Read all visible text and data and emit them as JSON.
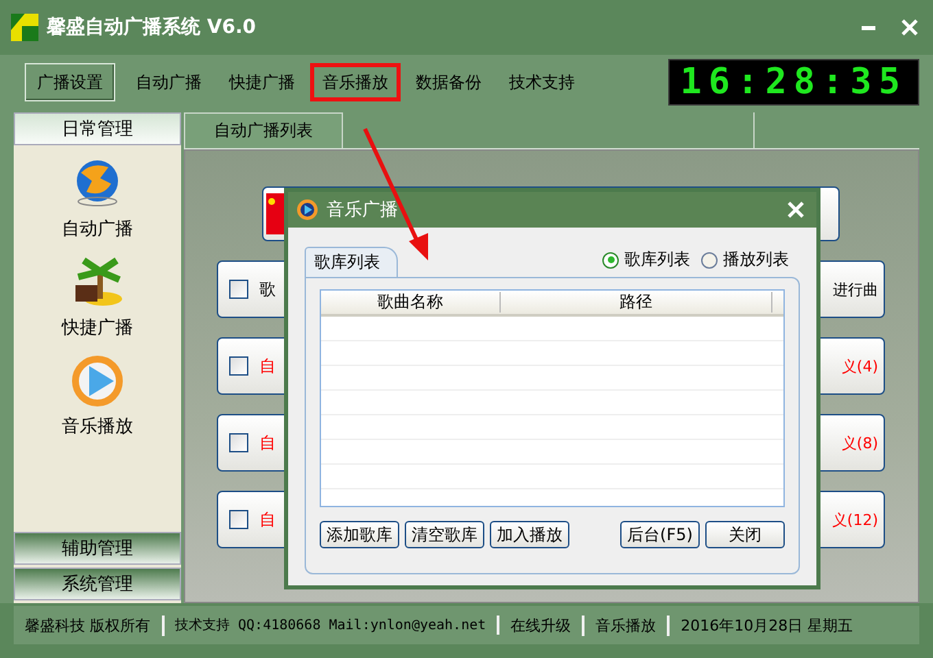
{
  "window": {
    "title": "馨盛自动广播系统 V6.0"
  },
  "menu": [
    {
      "label": "广播设置",
      "selected": true,
      "annotated": false
    },
    {
      "label": "自动广播",
      "selected": false,
      "annotated": false
    },
    {
      "label": "快捷广播",
      "selected": false,
      "annotated": false
    },
    {
      "label": "音乐播放",
      "selected": false,
      "annotated": true
    },
    {
      "label": "数据备份",
      "selected": false,
      "annotated": false
    },
    {
      "label": "技术支持",
      "selected": false,
      "annotated": false
    }
  ],
  "clock": "16:28:35",
  "sidebar": {
    "sections": [
      {
        "label": "日常管理",
        "expanded": true,
        "items": [
          {
            "label": "自动广播",
            "kind": "globe"
          },
          {
            "label": "快捷广播",
            "kind": "palm"
          },
          {
            "label": "音乐播放",
            "kind": "play"
          }
        ]
      },
      {
        "label": "辅助管理",
        "expanded": false
      },
      {
        "label": "系统管理",
        "expanded": false
      }
    ]
  },
  "tabs": [
    {
      "label": "自动广播列表",
      "selected": true
    }
  ],
  "cards": [
    {
      "kind": "flag"
    },
    {
      "kind": "row",
      "checked": false,
      "left_text": "歌",
      "right_text": "进行曲",
      "color": "#000000"
    },
    {
      "kind": "row",
      "checked": false,
      "left_text": "自",
      "right_text": "义(4)",
      "color": "#ff0000"
    },
    {
      "kind": "row",
      "checked": false,
      "left_text": "自",
      "right_text": "义(8)",
      "color": "#ff0000"
    },
    {
      "kind": "row",
      "checked": false,
      "left_text": "自",
      "right_text": "义(12)",
      "color": "#ff0000"
    }
  ],
  "dialog": {
    "title": "音乐广播",
    "tabs": [
      {
        "label": "歌库列表",
        "selected": true
      }
    ],
    "radios": [
      {
        "label": "歌库列表",
        "selected": true
      },
      {
        "label": "播放列表",
        "selected": false
      }
    ],
    "table": {
      "columns": [
        "歌曲名称",
        "路径"
      ]
    },
    "button_groups": [
      [
        "添加歌库",
        "清空歌库",
        "加入播放"
      ],
      [
        "后台(F5)",
        "关闭"
      ]
    ]
  },
  "status_bar": [
    "馨盛科技 版权所有",
    "技术支持 QQ:4180668 Mail:ynlon@yeah.net",
    "在线升级",
    "音乐播放",
    "2016年10月28日 星期五"
  ]
}
